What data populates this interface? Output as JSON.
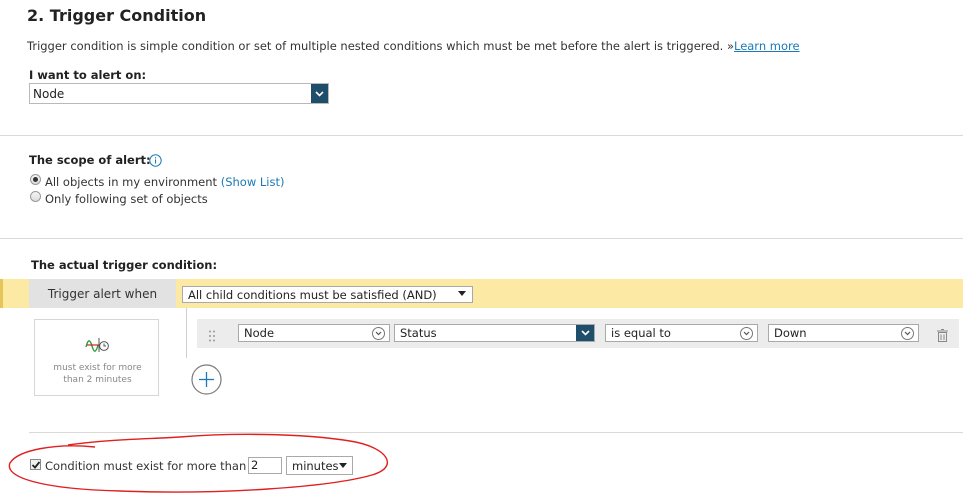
{
  "section": {
    "title": "2. Trigger Condition",
    "description": "Trigger condition is simple condition or set of multiple nested conditions which must be met before the alert is triggered.",
    "learn_more_prefix": "»",
    "learn_more": "Learn more"
  },
  "alert_on": {
    "label": "I want to alert on:",
    "value": "Node"
  },
  "scope": {
    "label": "The scope of alert:",
    "info_icon": "info-icon",
    "options": [
      {
        "label": "All objects in my environment",
        "link": "(Show List)",
        "selected": true
      },
      {
        "label": "Only following set of objects",
        "selected": false
      }
    ]
  },
  "trigger": {
    "label": "The actual trigger condition:",
    "when_label": "Trigger alert when",
    "group_select": "All child conditions must be satisfied (AND)",
    "condition": {
      "object": "Node",
      "field": "Status",
      "operator": "is equal to",
      "value": "Down"
    },
    "summary_text": "must exist for more than 2 minutes",
    "add_icon": "plus-circle-icon",
    "delete_icon": "trash-icon",
    "drag_icon": "drag-handle-icon"
  },
  "duration": {
    "checked": true,
    "label": "Condition must exist for more than",
    "value": "2",
    "unit": "minutes"
  },
  "colors": {
    "accent": "#1f4e6a",
    "link": "#1a7ab8",
    "highlight": "#fce9a4",
    "annotation": "#e02020"
  }
}
